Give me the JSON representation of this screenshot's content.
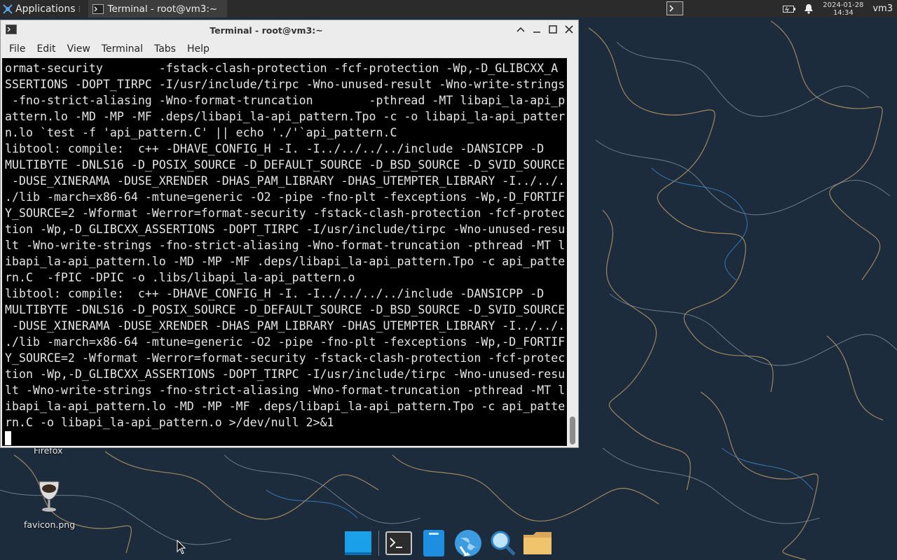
{
  "top_panel": {
    "applications_label": "Applications",
    "applications_sep": "⁝",
    "task_label": "Terminal - root@vm3:~",
    "clock_date": "2024-01-28",
    "clock_time": "14:34",
    "user": "vm3"
  },
  "terminal_window": {
    "title": "Terminal - root@vm3:~",
    "menu": [
      "File",
      "Edit",
      "View",
      "Terminal",
      "Tabs",
      "Help"
    ],
    "lines": [
      "ormat-security        -fstack-clash-protection -fcf-protection -Wp,-D_GLIBCXX_A",
      "SSERTIONS -DOPT_TIRPC -I/usr/include/tirpc -Wno-unused-result -Wno-write-strings",
      " -fno-strict-aliasing -Wno-format-truncation        -pthread -MT libapi_la-api_p",
      "attern.lo -MD -MP -MF .deps/libapi_la-api_pattern.Tpo -c -o libapi_la-api_patter",
      "n.lo `test -f 'api_pattern.C' || echo './'`api_pattern.C",
      "libtool: compile:  c++ -DHAVE_CONFIG_H -I. -I../../../../include -DANSICPP -D",
      "MULTIBYTE -DNLS16 -D_POSIX_SOURCE -D_DEFAULT_SOURCE -D_BSD_SOURCE -D_SVID_SOURCE",
      " -DUSE_XINERAMA -DUSE_XRENDER -DHAS_PAM_LIBRARY -DHAS_UTEMPTER_LIBRARY -I../../.",
      "./lib -march=x86-64 -mtune=generic -O2 -pipe -fno-plt -fexceptions -Wp,-D_FORTIF",
      "Y_SOURCE=2 -Wformat -Werror=format-security -fstack-clash-protection -fcf-protec",
      "tion -Wp,-D_GLIBCXX_ASSERTIONS -DOPT_TIRPC -I/usr/include/tirpc -Wno-unused-resu",
      "lt -Wno-write-strings -fno-strict-aliasing -Wno-format-truncation -pthread -MT l",
      "ibapi_la-api_pattern.lo -MD -MP -MF .deps/libapi_la-api_pattern.Tpo -c api_patte",
      "rn.C  -fPIC -DPIC -o .libs/libapi_la-api_pattern.o",
      "libtool: compile:  c++ -DHAVE_CONFIG_H -I. -I../../../../include -DANSICPP -D",
      "MULTIBYTE -DNLS16 -D_POSIX_SOURCE -D_DEFAULT_SOURCE -D_BSD_SOURCE -D_SVID_SOURCE",
      " -DUSE_XINERAMA -DUSE_XRENDER -DHAS_PAM_LIBRARY -DHAS_UTEMPTER_LIBRARY -I../../.",
      "./lib -march=x86-64 -mtune=generic -O2 -pipe -fno-plt -fexceptions -Wp,-D_FORTIF",
      "Y_SOURCE=2 -Wformat -Werror=format-security -fstack-clash-protection -fcf-protec",
      "tion -Wp,-D_GLIBCXX_ASSERTIONS -DOPT_TIRPC -I/usr/include/tirpc -Wno-unused-resu",
      "lt -Wno-write-strings -fno-strict-aliasing -Wno-format-truncation -pthread -MT l",
      "ibapi_la-api_pattern.lo -MD -MP -MF .deps/libapi_la-api_pattern.Tpo -c api_patte",
      "rn.C -o libapi_la-api_pattern.o >/dev/null 2>&1"
    ]
  },
  "desktop": {
    "icons": [
      {
        "label": "Firefox",
        "icon": "firefox-icon"
      },
      {
        "label": "favicon.png",
        "icon": "image-file-icon"
      }
    ]
  },
  "dock": {
    "items": [
      {
        "name": "show-desktop",
        "icon": "desktop-icon"
      },
      {
        "name": "terminal",
        "icon": "terminal-icon"
      },
      {
        "name": "mail",
        "icon": "mail-icon"
      },
      {
        "name": "web-browser",
        "icon": "globe-icon"
      },
      {
        "name": "app-finder",
        "icon": "magnifier-icon"
      },
      {
        "name": "file-manager",
        "icon": "folder-icon"
      }
    ]
  },
  "colors": {
    "wallpaper": "#1c2b3c",
    "panel": "#2b2b2b",
    "terminal_bg": "#000000",
    "terminal_fg": "#e5e5e5"
  }
}
